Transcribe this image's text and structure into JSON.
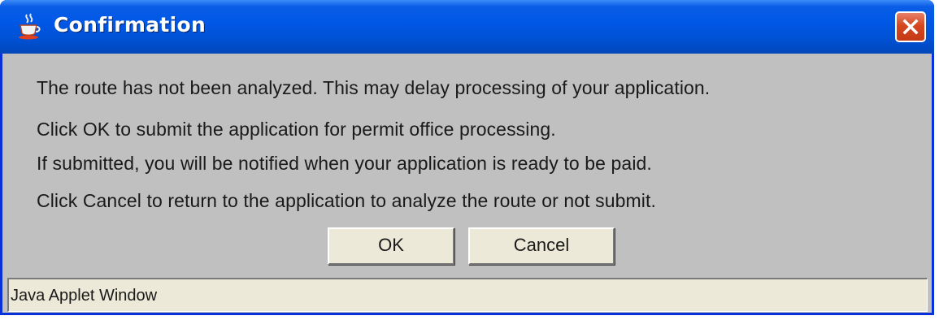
{
  "window": {
    "title": "Confirmation",
    "title_icon": "java-coffee-cup-icon",
    "close_icon": "close-icon"
  },
  "message": {
    "lines": [
      "The route has not been analyzed. This may delay processing of your application.",
      "Click OK to submit the application for permit office processing.",
      "If submitted, you will be notified when your application is ready to be paid.",
      "Click Cancel to return to the application to analyze the route or not submit."
    ]
  },
  "buttons": {
    "ok_label": "OK",
    "cancel_label": "Cancel"
  },
  "status": {
    "text": "Java Applet Window"
  },
  "colors": {
    "titlebar": "#0058e6",
    "close_button": "#d5471f",
    "body": "#c0c0c0",
    "button_face": "#ece9d8"
  }
}
